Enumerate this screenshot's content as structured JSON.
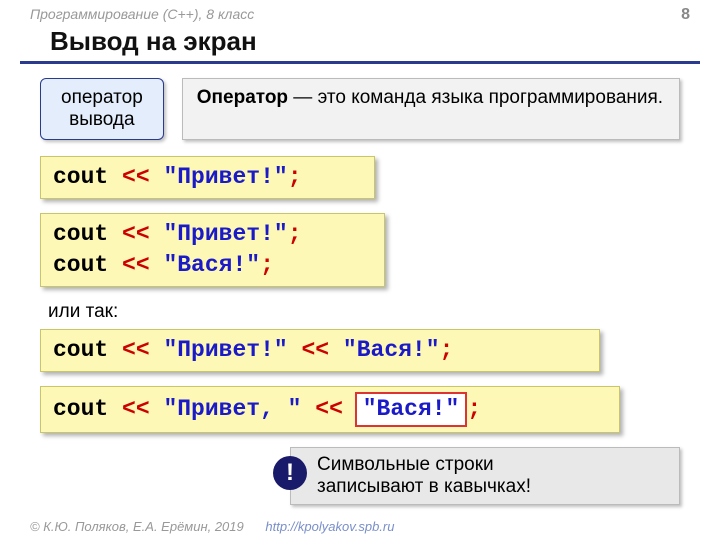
{
  "header": {
    "course": "Программирование (C++), 8 класс",
    "page": "8"
  },
  "title": "Вывод на экран",
  "callout": {
    "line1": "оператор",
    "line2": "вывода"
  },
  "definition": {
    "term": "Оператор",
    "rest": " — это команда языка программирования."
  },
  "code1": {
    "keyword": "cout",
    "op": "<<",
    "str": "\"Привет!\"",
    "semi": ";"
  },
  "code2a": {
    "keyword": "cout",
    "op": "<<",
    "str": "\"Привет!\"",
    "semi": ";"
  },
  "code2b": {
    "keyword": "cout",
    "op": "<<",
    "str": "\"Вася!\"",
    "semi": ";"
  },
  "or_label": "или так:",
  "code3": {
    "keyword": "cout",
    "op1": "<<",
    "str1": "\"Привет!\"",
    "op2": "<<",
    "str2": "\"Вася!\"",
    "semi": ";"
  },
  "code4": {
    "keyword": "cout",
    "op1": "<<",
    "str1": "\"Привет, \"",
    "op2": "<<",
    "hl": "\"Вася!\"",
    "semi": ";"
  },
  "note": {
    "bang": "!",
    "line1": "Символьные строки",
    "line2": "записывают в кавычках!"
  },
  "footer": {
    "copyright": "© К.Ю. Поляков, Е.А. Ерёмин, 2019",
    "url": "http://kpolyakov.spb.ru"
  }
}
